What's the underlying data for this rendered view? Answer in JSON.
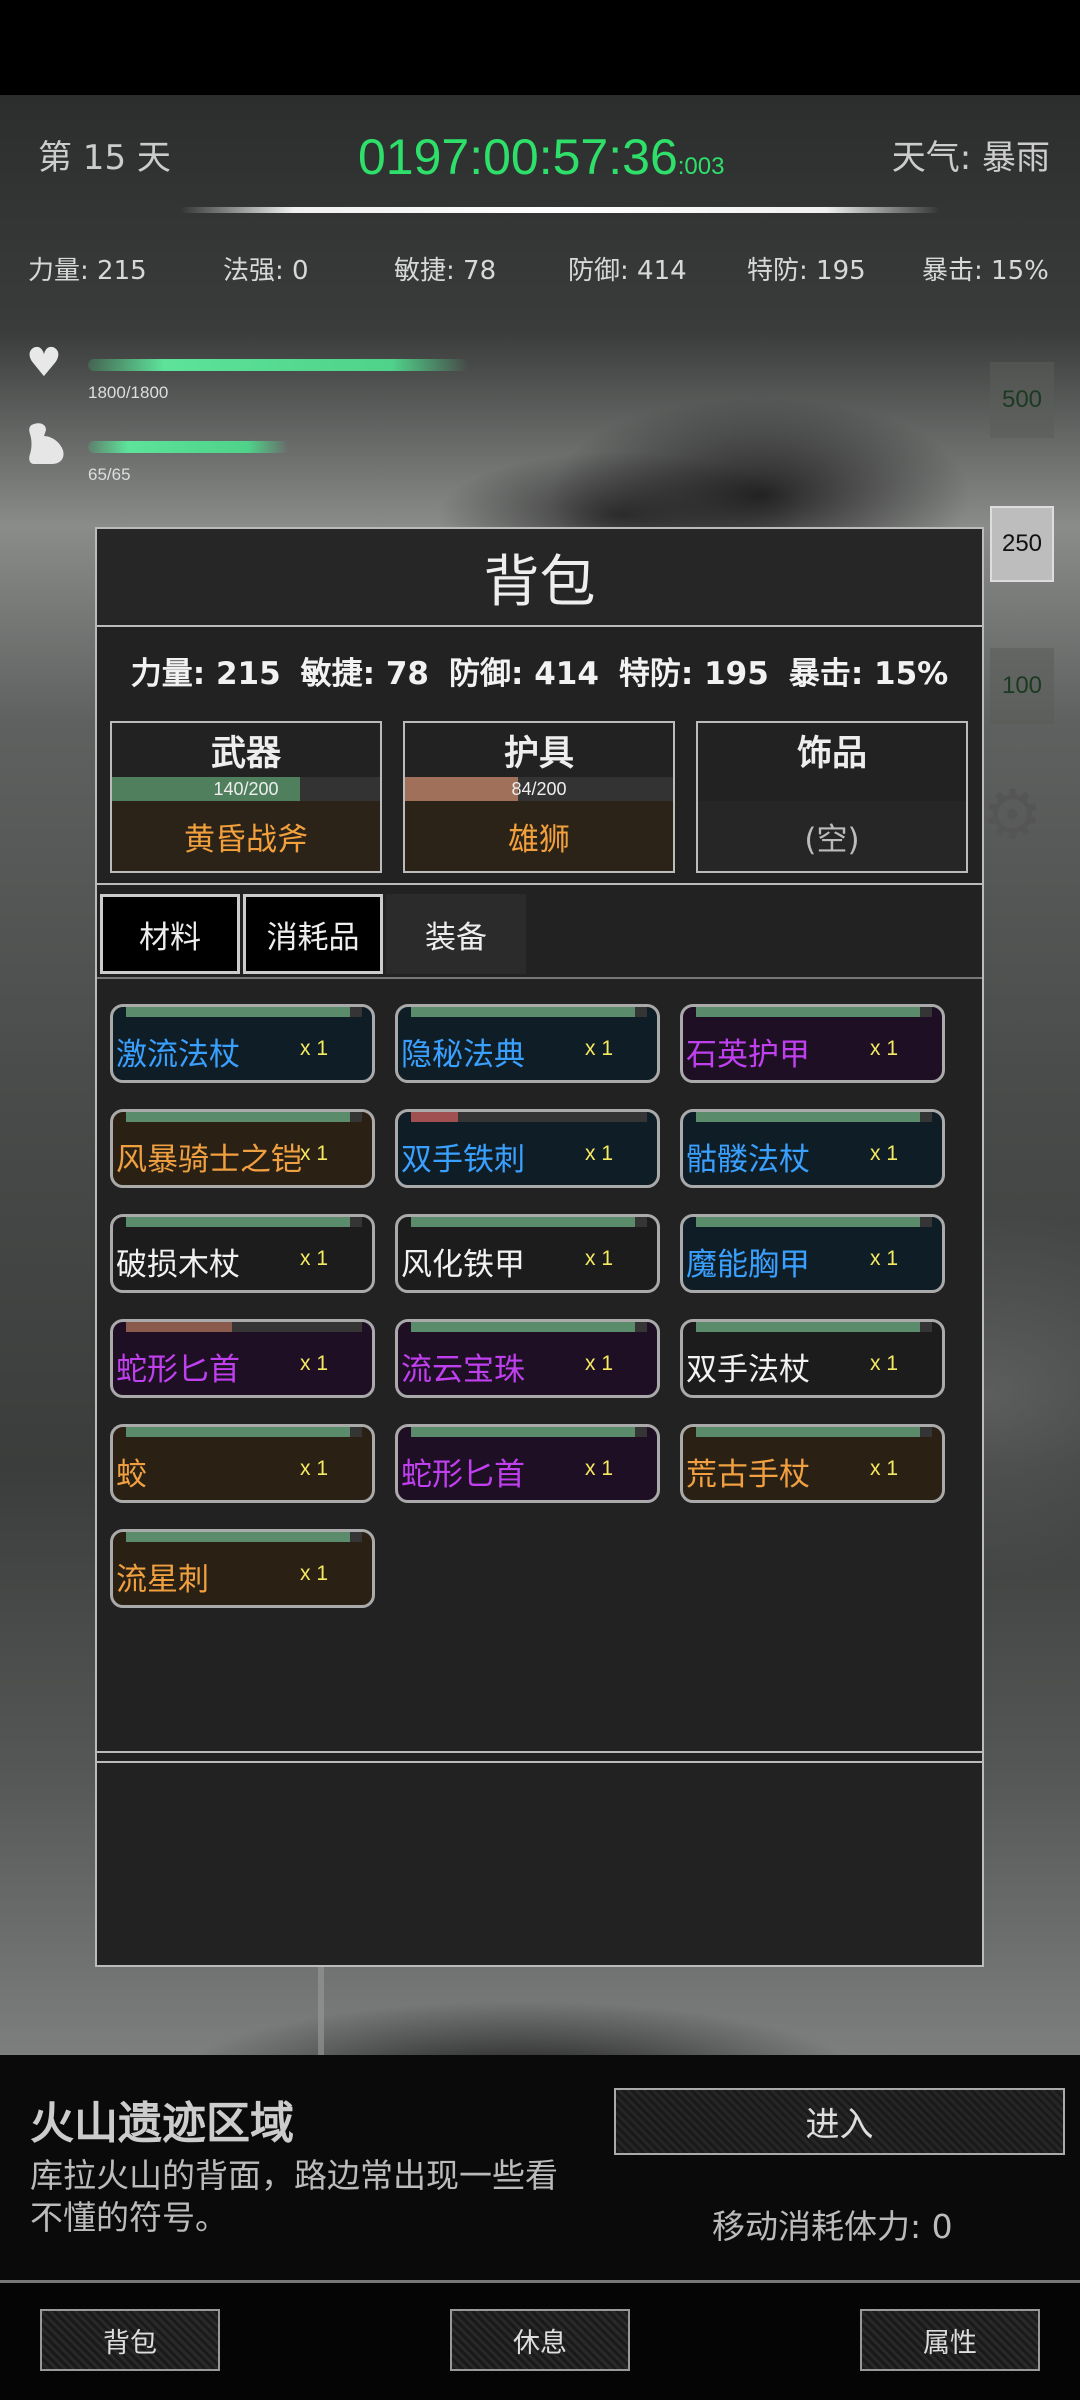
{
  "hud": {
    "day": "第 15 天",
    "timer": "0197:00:57:36",
    "timer_ms": ":003",
    "weather": "天气: 暴雨"
  },
  "top_stats": [
    "力量: 215",
    "法强: 0",
    "敏捷: 78",
    "防御: 414",
    "特防: 195",
    "暴击: 15%"
  ],
  "vitals": {
    "health": {
      "text": "1800/1800",
      "current": 1800,
      "max": 1800
    },
    "stamina": {
      "text": "65/65",
      "current": 65,
      "max": 65
    }
  },
  "bet_chips": [
    {
      "value": "500",
      "active": false
    },
    {
      "value": "250",
      "active": true
    },
    {
      "value": "100",
      "active": false
    }
  ],
  "panel": {
    "title": "背包",
    "stats": [
      "力量: 215",
      "敏捷: 78",
      "防御: 414",
      "特防: 195",
      "暴击: 15%"
    ],
    "slots": [
      {
        "label": "武器",
        "bar_text": "140/200",
        "fill": 0.7,
        "bar_color": "#4f7f5c",
        "item": "黄昏战斧"
      },
      {
        "label": "护具",
        "bar_text": "84/200",
        "fill": 0.42,
        "bar_color": "#a0705a",
        "item": "雄狮"
      },
      {
        "label": "饰品",
        "bar_text": "",
        "fill": 0,
        "bar_color": "#4f7f5c",
        "item": "(空)"
      }
    ],
    "tabs": [
      "材料",
      "消耗品",
      "装备"
    ],
    "items": [
      {
        "name": "激流法杖",
        "count": "x 1",
        "color": "#3aa0ff",
        "bg": "#0f1e26",
        "fill": 0.95,
        "bar": "#5a8c6c"
      },
      {
        "name": "隐秘法典",
        "count": "x 1",
        "color": "#3aa0ff",
        "bg": "#0f1e26",
        "fill": 0.95,
        "bar": "#5a8c6c"
      },
      {
        "name": "石英护甲",
        "count": "x 1",
        "color": "#c040f0",
        "bg": "#1e0f24",
        "fill": 0.95,
        "bar": "#5a8c6c"
      },
      {
        "name": "风暴骑士之铠",
        "count": "x 1",
        "color": "#f0a040",
        "bg": "#2a2014",
        "fill": 0.95,
        "bar": "#5a8c6c"
      },
      {
        "name": "双手铁刺",
        "count": "x 1",
        "color": "#3aa0ff",
        "bg": "#0f1e26",
        "fill": 0.2,
        "bar": "#a05050"
      },
      {
        "name": "骷髅法杖",
        "count": "x 1",
        "color": "#3aa0ff",
        "bg": "#0f1e26",
        "fill": 0.95,
        "bar": "#5a8c6c"
      },
      {
        "name": "破损木杖",
        "count": "x 1",
        "color": "#f2f2f2",
        "bg": "#1c1c1c",
        "fill": 0.95,
        "bar": "#5a8c6c"
      },
      {
        "name": "风化铁甲",
        "count": "x 1",
        "color": "#f2f2f2",
        "bg": "#1c1c1c",
        "fill": 0.95,
        "bar": "#5a8c6c"
      },
      {
        "name": "魔能胸甲",
        "count": "x 1",
        "color": "#3aa0ff",
        "bg": "#0f1e26",
        "fill": 0.95,
        "bar": "#5a8c6c"
      },
      {
        "name": "蛇形匕首",
        "count": "x 1",
        "color": "#c040f0",
        "bg": "#1e0f24",
        "fill": 0.45,
        "bar": "#8a5a4c"
      },
      {
        "name": "流云宝珠",
        "count": "x 1",
        "color": "#c040f0",
        "bg": "#1e0f24",
        "fill": 0.95,
        "bar": "#5a8c6c"
      },
      {
        "name": "双手法杖",
        "count": "x 1",
        "color": "#f2f2f2",
        "bg": "#1c1c1c",
        "fill": 0.95,
        "bar": "#5a8c6c"
      },
      {
        "name": "蛟",
        "count": "x 1",
        "color": "#f0a040",
        "bg": "#2a2014",
        "fill": 0.95,
        "bar": "#5a8c6c"
      },
      {
        "name": "蛇形匕首",
        "count": "x 1",
        "color": "#c040f0",
        "bg": "#1e0f24",
        "fill": 0.95,
        "bar": "#5a8c6c"
      },
      {
        "name": "荒古手杖",
        "count": "x 1",
        "color": "#f0a040",
        "bg": "#2a2014",
        "fill": 0.95,
        "bar": "#5a8c6c"
      },
      {
        "name": "流星刺",
        "count": "x 1",
        "color": "#f0a040",
        "bg": "#2a2014",
        "fill": 0.95,
        "bar": "#5a8c6c"
      }
    ]
  },
  "zone": {
    "name": "火山遗迹区域",
    "description": "库拉火山的背面，路边常出现一些看不懂的符号。",
    "enter_label": "进入",
    "move_cost": "移动消耗体力: 0"
  },
  "nav": [
    "背包",
    "休息",
    "属性"
  ],
  "icons": {
    "health": "heart-icon",
    "stamina": "flexed-arm-icon",
    "settings": "gear-icon"
  }
}
